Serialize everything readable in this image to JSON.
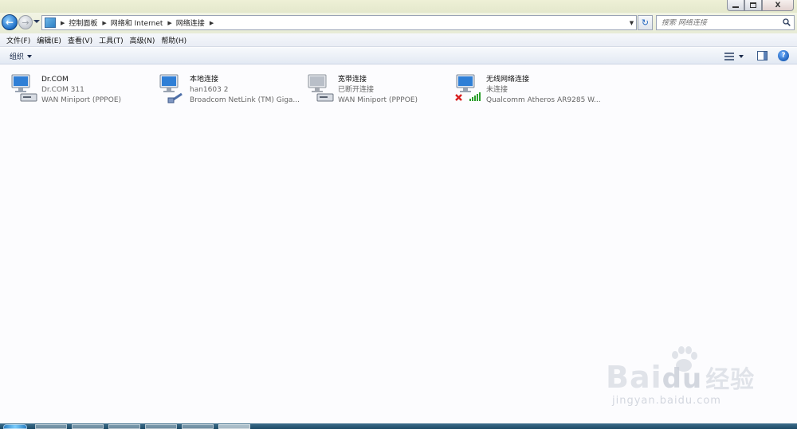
{
  "window": {
    "minimize_icon": "minimize-icon",
    "maximize_icon": "restore-icon",
    "close_label": "X"
  },
  "nav": {
    "breadcrumbs": [
      "控制面板",
      "网络和 Internet",
      "网络连接"
    ],
    "search_placeholder": "搜索 网络连接"
  },
  "menu": {
    "items": [
      "文件(F)",
      "编辑(E)",
      "查看(V)",
      "工具(T)",
      "高级(N)",
      "帮助(H)"
    ]
  },
  "toolbar": {
    "organize_label": "组织",
    "help_label": "?"
  },
  "connections": [
    {
      "name": "Dr.COM",
      "status": "Dr.COM  311",
      "device": "WAN Miniport (PPPOE)",
      "icon": "wan-connection-icon",
      "state": "normal"
    },
    {
      "name": "本地连接",
      "status": "han1603  2",
      "device": "Broadcom NetLink (TM) Giga...",
      "icon": "lan-connection-icon",
      "state": "normal"
    },
    {
      "name": "宽带连接",
      "status": "已断开连接",
      "device": "WAN Miniport (PPPOE)",
      "icon": "broadband-connection-icon",
      "state": "disconnected"
    },
    {
      "name": "无线网络连接",
      "status": "未连接",
      "device": "Qualcomm Atheros AR9285 W...",
      "icon": "wireless-connection-icon",
      "state": "not-connected"
    }
  ],
  "watermark": {
    "brand_logo": "Baidu经验",
    "url": "jingyan.baidu.com"
  },
  "colors": {
    "accent": "#1f6fc6",
    "content_bg": "#fcfcfe",
    "status_gray": "#666666"
  }
}
